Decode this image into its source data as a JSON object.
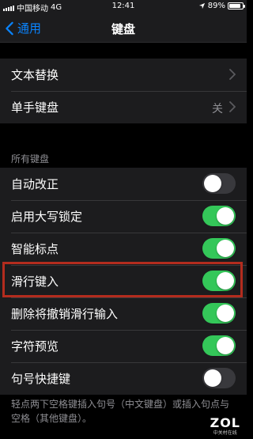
{
  "status_bar": {
    "carrier": "中国移动",
    "network": "4G",
    "time": "12:41",
    "battery_percent": "89%",
    "battery_level": 0.89
  },
  "nav": {
    "back_label": "通用",
    "title": "键盘"
  },
  "group1": {
    "items": [
      {
        "label": "文本替换",
        "value": ""
      },
      {
        "label": "单手键盘",
        "value": "关"
      }
    ]
  },
  "section_all_keyboards": {
    "header": "所有键盘",
    "items": [
      {
        "label": "自动改正",
        "on": false
      },
      {
        "label": "启用大写锁定",
        "on": true
      },
      {
        "label": "智能标点",
        "on": true
      },
      {
        "label": "滑行键入",
        "on": true
      },
      {
        "label": "删除将撤销滑行输入",
        "on": true
      },
      {
        "label": "字符预览",
        "on": true
      },
      {
        "label": "句号快捷键",
        "on": false
      }
    ],
    "footer": "轻点两下空格键插入句号（中文键盘）或插入句点与空格（其他键盘）。"
  },
  "watermark": {
    "logo": "ZOL",
    "sub": "中关村在线"
  },
  "colors": {
    "accent": "#0a84ff",
    "toggle_on": "#34c759",
    "highlight": "#b32c1e"
  }
}
